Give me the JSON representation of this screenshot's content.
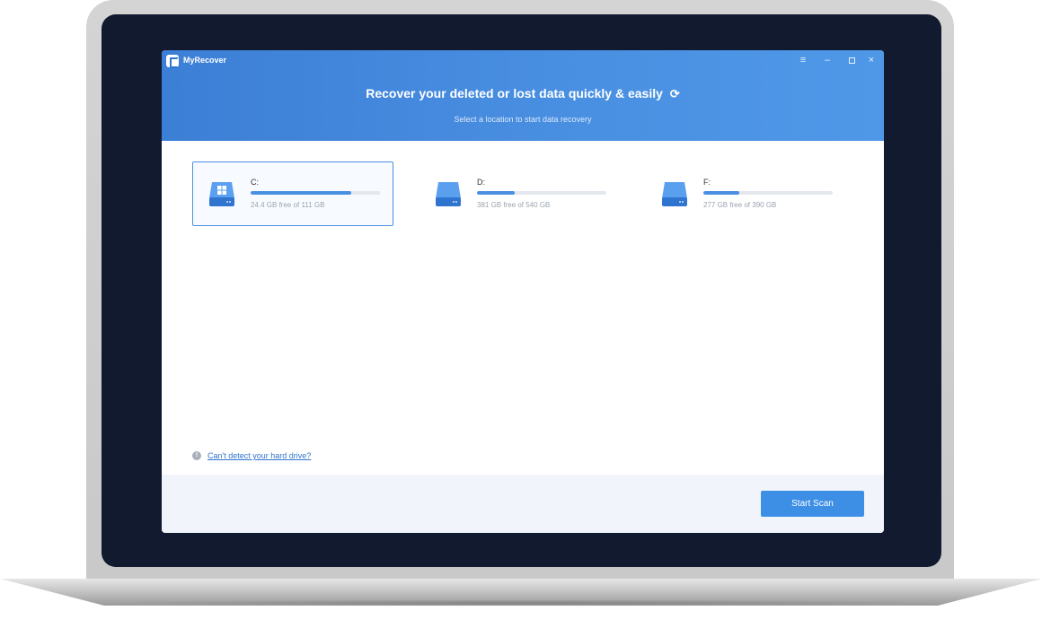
{
  "app": {
    "name": "MyRecover",
    "title": "Recover your deleted or lost data quickly & easily",
    "subtitle": "Select a location to start data recovery"
  },
  "window_controls": {
    "menu": "≡",
    "minimize": "–",
    "close": "×"
  },
  "drives": [
    {
      "label": "C:",
      "info": "24.4 GB free of 111 GB",
      "used_fraction": 0.78,
      "selected": true,
      "icon": "windows-drive-icon"
    },
    {
      "label": "D:",
      "info": "381 GB free of 540 GB",
      "used_fraction": 0.29,
      "selected": false,
      "icon": "hard-drive-icon"
    },
    {
      "label": "F:",
      "info": "277 GB free of 390 GB",
      "used_fraction": 0.28,
      "selected": false,
      "icon": "hard-drive-icon"
    }
  ],
  "help": {
    "link_text": "Can't detect your hard drive?"
  },
  "footer": {
    "start_button": "Start Scan"
  },
  "colors": {
    "accent": "#4a90e2",
    "header_start": "#3c7fd6",
    "footer_bg": "#f1f5fb"
  }
}
